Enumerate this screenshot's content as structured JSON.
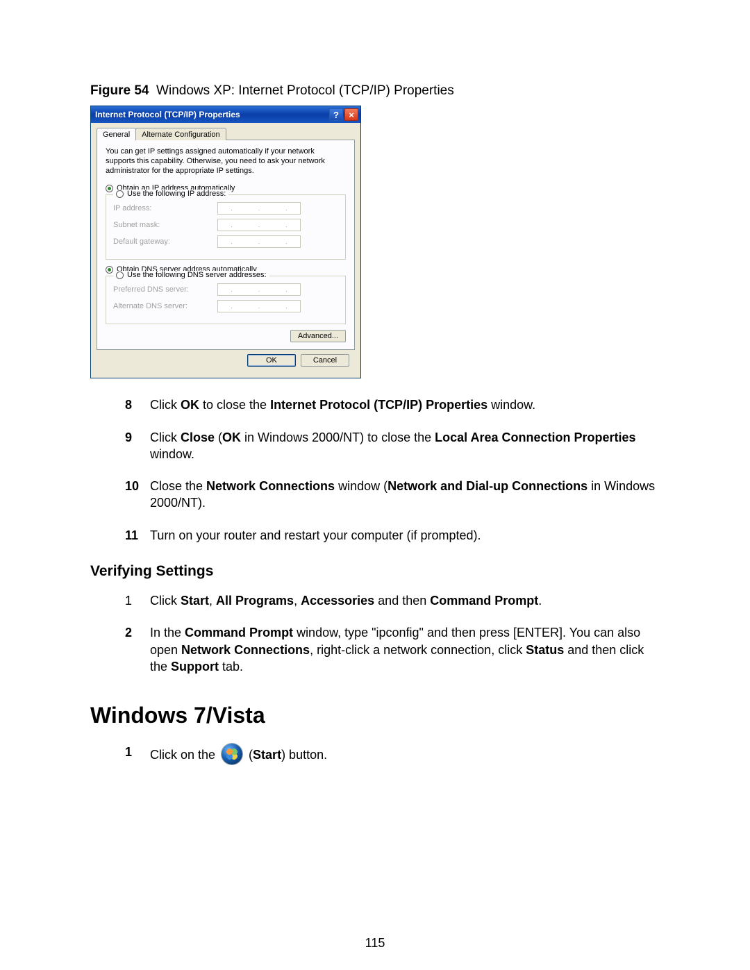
{
  "figure": {
    "label": "Figure 54",
    "caption": "Windows XP: Internet Protocol (TCP/IP) Properties"
  },
  "dialog": {
    "title": "Internet Protocol (TCP/IP) Properties",
    "tabs": {
      "general": "General",
      "alt": "Alternate Configuration"
    },
    "description": "You can get IP settings assigned automatically if your network supports this capability. Otherwise, you need to ask your network administrator for the appropriate IP settings.",
    "radio": {
      "ip_auto": "Obtain an IP address automatically",
      "ip_manual": "Use the following IP address:",
      "dns_auto": "Obtain DNS server address automatically",
      "dns_manual": "Use the following DNS server addresses:"
    },
    "fields": {
      "ip": "IP address:",
      "mask": "Subnet mask:",
      "gw": "Default gateway:",
      "pdns": "Preferred DNS server:",
      "adns": "Alternate DNS server:"
    },
    "buttons": {
      "advanced": "Advanced...",
      "ok": "OK",
      "cancel": "Cancel"
    }
  },
  "steps_a": {
    "n8": "8",
    "n9": "9",
    "n10": "10",
    "n11": "11",
    "s8a": "Click ",
    "s8b": "OK",
    "s8c": " to close the ",
    "s8d": "Internet Protocol (TCP/IP) Properties",
    "s8e": " window.",
    "s9a": "Click ",
    "s9b": "Close",
    "s9c": " (",
    "s9d": "OK",
    "s9e": " in Windows 2000/NT) to close the ",
    "s9f": "Local Area Connection Properties",
    "s9g": " window.",
    "s10a": " Close the ",
    "s10b": "Network Connections",
    "s10c": " window (",
    "s10d": "Network and Dial-up Connections",
    "s10e": " in Windows 2000/NT).",
    "s11": "Turn on your router and restart your computer (if prompted)."
  },
  "subhead": "Verifying Settings",
  "steps_b": {
    "n1": "1",
    "n2": "2",
    "s1a": "Click ",
    "s1b": "Start",
    "s1c": ", ",
    "s1d": "All Programs",
    "s1e": ", ",
    "s1f": "Accessories",
    "s1g": " and then ",
    "s1h": "Command Prompt",
    "s1i": ".",
    "s2a": "In the ",
    "s2b": "Command Prompt",
    "s2c": " window, type \"ipconfig\" and then press [ENTER]. You can also open ",
    "s2d": "Network Connections",
    "s2e": ", right-click a network connection, click ",
    "s2f": "Status",
    "s2g": " and then click the ",
    "s2h": "Support",
    "s2i": " tab."
  },
  "section": "Windows 7/Vista",
  "steps_c": {
    "n1": "1",
    "s1a": "Click on the ",
    "s1b": " (",
    "s1c": "Start",
    "s1d": ") button."
  },
  "pagenum": "115"
}
